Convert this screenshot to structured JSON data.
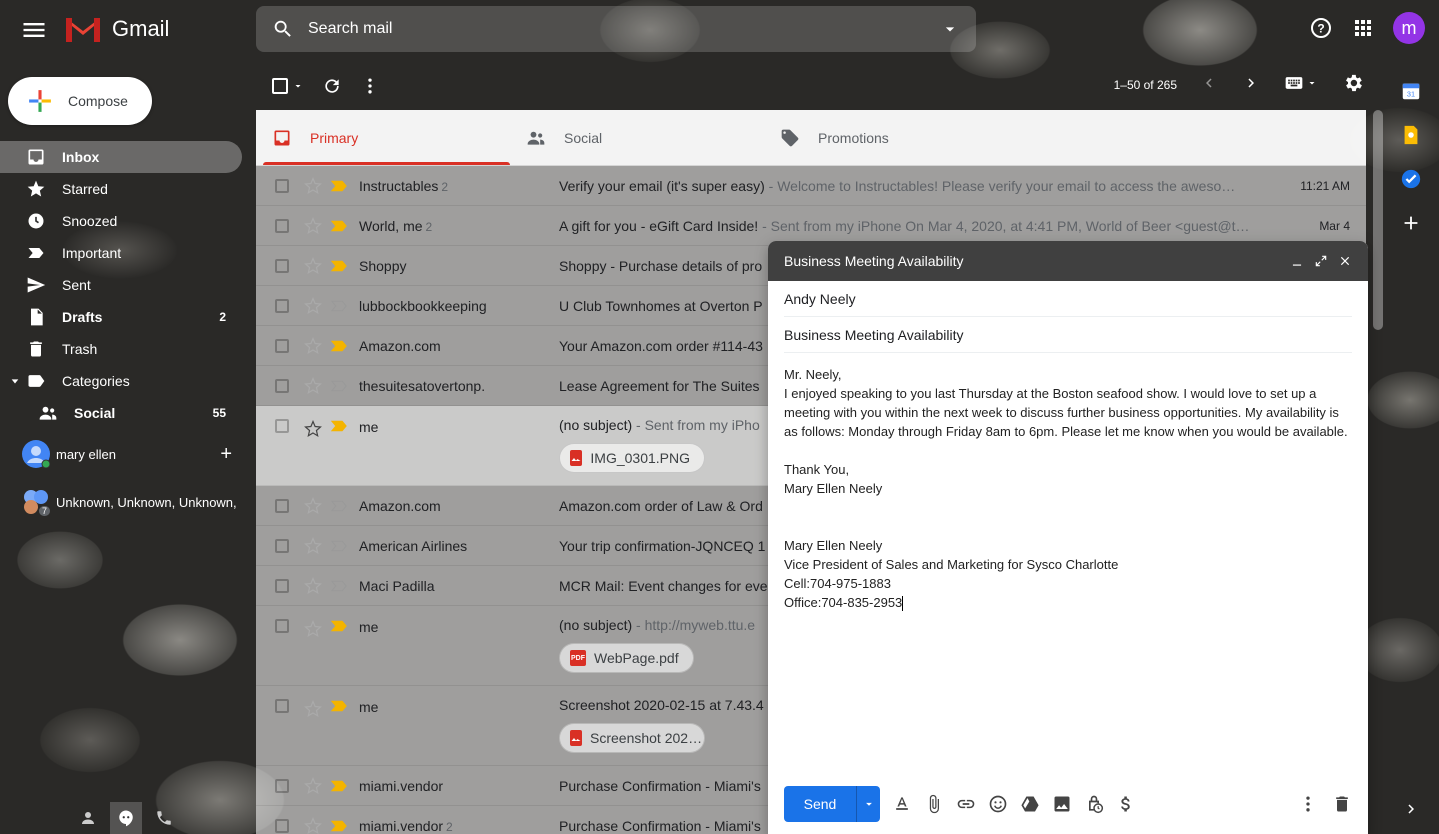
{
  "header": {
    "brand": "Gmail",
    "search_placeholder": "Search mail",
    "avatar_letter": "m"
  },
  "sidebar": {
    "compose_label": "Compose",
    "items": [
      {
        "label": "Inbox",
        "count": ""
      },
      {
        "label": "Starred",
        "count": ""
      },
      {
        "label": "Snoozed",
        "count": ""
      },
      {
        "label": "Important",
        "count": ""
      },
      {
        "label": "Sent",
        "count": ""
      },
      {
        "label": "Drafts",
        "count": "2"
      },
      {
        "label": "Trash",
        "count": ""
      },
      {
        "label": "Categories",
        "count": ""
      },
      {
        "label": "Social",
        "count": "55"
      }
    ],
    "chat_user": "mary ellen",
    "chat_group": "Unknown, Unknown, Unknown,",
    "chat_group_count": "7"
  },
  "toolbar": {
    "pager": "1–50 of 265"
  },
  "tabs": [
    {
      "label": "Primary"
    },
    {
      "label": "Social"
    },
    {
      "label": "Promotions"
    }
  ],
  "emails": [
    {
      "sender": "Instructables",
      "count": "2",
      "subject": "Verify your email (it's super easy)",
      "snippet": " - Welcome to Instructables! Please verify your email to access the aweso…",
      "date": "11:21 AM",
      "starred": false,
      "important": true
    },
    {
      "sender": "World, me",
      "count": "2",
      "subject": "A gift for you - eGift Card Inside!",
      "snippet": " - Sent from my iPhone On Mar 4, 2020, at 4:41 PM, World of Beer <guest@t…",
      "date": "Mar 4",
      "starred": false,
      "important": true
    },
    {
      "sender": "Shoppy",
      "count": "",
      "subject": "Shoppy - Purchase details of pro",
      "snippet": "",
      "date": "",
      "starred": false,
      "important": true
    },
    {
      "sender": "lubbockbookkeeping",
      "count": "",
      "subject": "U Club Townhomes at Overton P",
      "snippet": "",
      "date": "",
      "starred": false,
      "important": false
    },
    {
      "sender": "Amazon.com",
      "count": "",
      "subject": "Your Amazon.com order #114-43",
      "snippet": "",
      "date": "",
      "starred": false,
      "important": true
    },
    {
      "sender": "thesuitesatovertonp.",
      "count": "",
      "subject": "Lease Agreement for The Suites",
      "snippet": "",
      "date": "",
      "starred": false,
      "important": false
    },
    {
      "sender": "me",
      "count": "",
      "subject": "(no subject)",
      "snippet": " - Sent from my iPho",
      "date": "",
      "starred": false,
      "important": true,
      "attachment": "IMG_0301.PNG",
      "attachment_type": "img"
    },
    {
      "sender": "Amazon.com",
      "count": "",
      "subject": "Amazon.com order of Law & Ord",
      "snippet": "",
      "date": "",
      "starred": false,
      "important": false
    },
    {
      "sender": "American Airlines",
      "count": "",
      "subject": "Your trip confirmation-JQNCEQ 1",
      "snippet": "",
      "date": "",
      "starred": false,
      "important": false
    },
    {
      "sender": "Maci Padilla",
      "count": "",
      "subject": "MCR Mail: Event changes for eve",
      "snippet": "",
      "date": "",
      "starred": false,
      "important": false
    },
    {
      "sender": "me",
      "count": "",
      "subject": "(no subject)",
      "snippet": " - http://myweb.ttu.e",
      "date": "",
      "starred": false,
      "important": true,
      "attachment": "WebPage.pdf",
      "attachment_type": "pdf"
    },
    {
      "sender": "me",
      "count": "",
      "subject": "Screenshot 2020-02-15 at 7.43.4",
      "snippet": "",
      "date": "",
      "starred": false,
      "important": true,
      "attachment": "Screenshot 202…",
      "attachment_type": "img"
    },
    {
      "sender": "miami.vendor",
      "count": "",
      "subject": "Purchase Confirmation - Miami's",
      "snippet": "",
      "date": "",
      "starred": false,
      "important": true
    },
    {
      "sender": "miami.vendor",
      "count": "2",
      "subject": "Purchase Confirmation - Miami's",
      "snippet": "",
      "date": "",
      "starred": false,
      "important": true
    }
  ],
  "compose": {
    "window_title": "Business Meeting Availability",
    "to": "Andy Neely",
    "subject": "Business Meeting Availability",
    "body_lines": [
      "Mr. Neely,",
      "I enjoyed speaking to you last Thursday at the Boston seafood show. I would love to set up a meeting with you within the next week to discuss further business opportunities. My availability is as follows: Monday through Friday 8am to 6pm. Please let me know when you would be available.",
      "",
      "Thank You,",
      "Mary Ellen Neely",
      "",
      "",
      "Mary Ellen Neely",
      "Vice President of Sales and Marketing for Sysco Charlotte",
      "Cell:704-975-1883",
      "Office:704-835-2953"
    ],
    "send_label": "Send"
  },
  "pdf_label": "PDF"
}
